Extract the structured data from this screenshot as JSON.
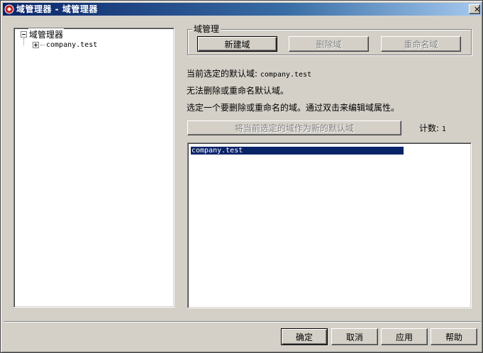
{
  "window": {
    "title": "域管理器 - 域管理器",
    "close_label": "✕"
  },
  "tree": {
    "root_label": "域管理器",
    "children": [
      "company.test"
    ]
  },
  "group": {
    "legend": "域管理",
    "new_label": "新建域",
    "delete_label": "删除域",
    "rename_label": "重命名域"
  },
  "info": {
    "current_default_label": "当前选定的默认域:",
    "current_default_value": "company.test",
    "cannot_modify": "无法删除或重命名默认域。",
    "instruction": "选定一个要删除或重命名的域。通过双击来编辑域属性。"
  },
  "set_default_label": "将当前选定的域作为新的默认域",
  "count": {
    "label": "计数:",
    "value": "1"
  },
  "list": {
    "items": [
      "company.test"
    ]
  },
  "footer": {
    "ok_label": "确定",
    "cancel_label": "取消",
    "apply_label": "应用",
    "help_label": "帮助"
  }
}
